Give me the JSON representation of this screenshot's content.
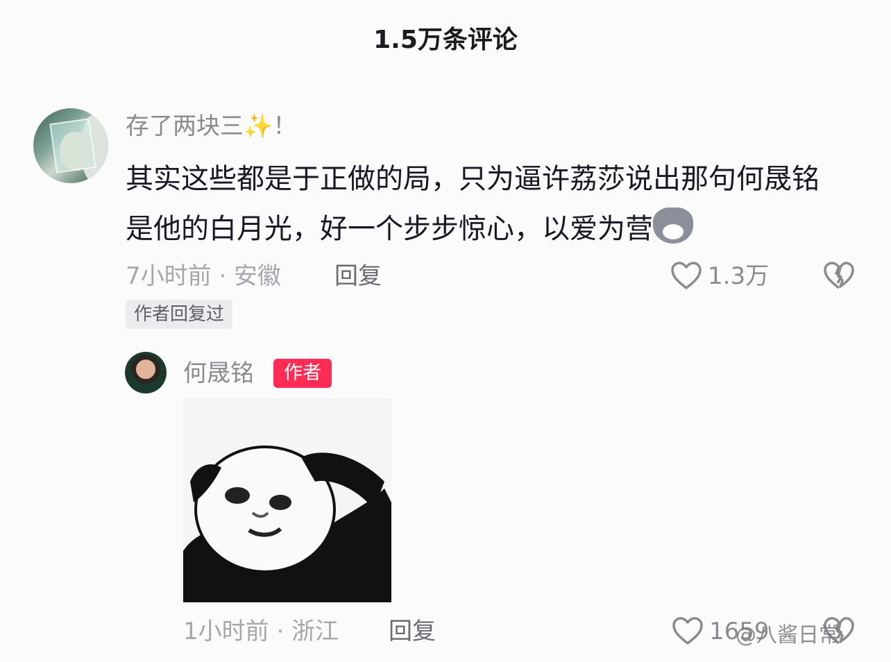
{
  "header": {
    "title": "1.5万条评论"
  },
  "comment": {
    "username": "存了两块三",
    "username_suffix": "！",
    "text": "其实这些都是于正做的局，只为逼许荔莎说出那句何晟铭是他的白月光，好一个步步惊心，以爱为营",
    "emoji_icon": "wolf-emoji-icon",
    "meta": "7小时前 · 安徽",
    "reply_label": "回复",
    "likes": "1.3万",
    "author_replied_tag": "作者回复过"
  },
  "reply": {
    "username": "何晟铭",
    "badge": "作者",
    "sticker_icon": "panda-meme-sticker",
    "meta": "1小时前 · 浙江",
    "reply_label": "回复",
    "likes": "1659"
  },
  "watermark": "@八酱日常",
  "colors": {
    "accent": "#fe2c55",
    "text": "#161823",
    "muted": "#8a8b91"
  }
}
